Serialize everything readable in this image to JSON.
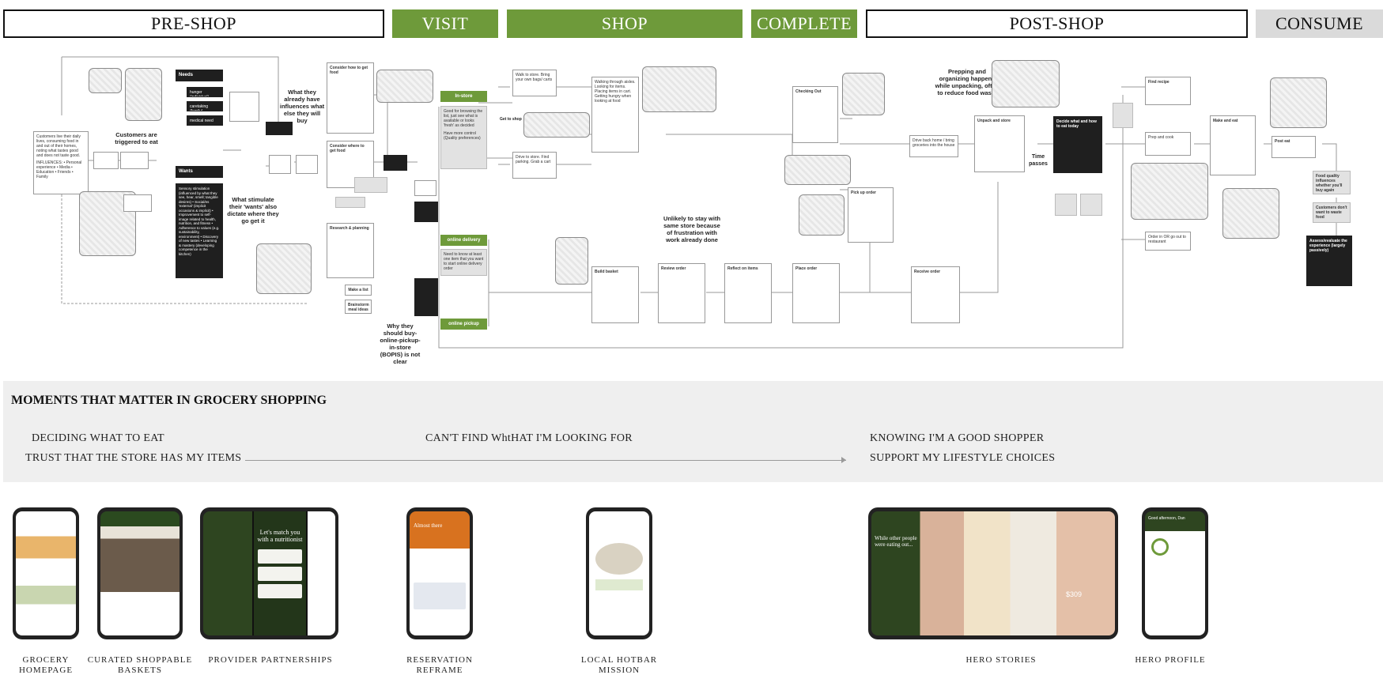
{
  "phases": {
    "pre_shop": "PRE-SHOP",
    "visit": "VISIT",
    "shop": "SHOP",
    "complete": "COMPLETE",
    "post_shop": "POST-SHOP",
    "consume": "CONSUME"
  },
  "colors": {
    "accent_green": "#6e9a3a",
    "dark_box": "#1f1f1f",
    "band_bg": "#efefef"
  },
  "flow": {
    "triggered": "Customers are triggered to eat",
    "needs": "Needs",
    "need_hunger": "hunger (individual)",
    "need_caretaking": "caretaking (family)",
    "need_medical": "medical need",
    "wants": "Wants",
    "wants_body": "Sensory stimulation (influenced by what they see, hear, smell; tangible desires) • Social/es 'external' (implicit occasions & implicit) • Improvement to self-image related to health, nutrition, and fitness • Adherence to values (e.g. sustainability, environment) • Discovery of new tastes • Learning & mastery (developing competence in the kitchen)",
    "customers_daily": "Customers live their daily lives, consuming food in and out of their homes, noting what tastes good and does not taste good.",
    "influences": "INFLUENCES: • Personal experience • Media • Education • Friends • Family",
    "annot_influence": "What they already have influences what else they will buy",
    "annot_wants": "What stimulate their 'wants' also dictate where they go get it",
    "consider_how": "Consider how to get food",
    "consider_where": "Consider where to get food",
    "research": "Research & planning",
    "make_list": "Make a list",
    "brainstorm": "Brainstorm meal ideas",
    "in_store": "In-store",
    "online_delivery": "online delivery",
    "online_pickup": "online pickup",
    "in_store_note": "Good for browsing the list, just see what is available or looks 'fresh' as decided",
    "in_store_note2": "Have more control (Quality preferences)",
    "delivery_note": "Need to know at least one item that you want to start online delivery order",
    "get_to_shop": "Get to shop",
    "walk": "Walk to store. Bring your own bags/ carts",
    "drive": "Drive to store. Find parking. Grab a cart",
    "browse": "Walking through aisles. Looking for items. Placing items in cart. Getting hungry when looking at food",
    "annot_bopis": "Why they should buy-online-pickup-in-store (BOPIS) is not clear",
    "annot_frustration": "Unlikely to stay with same store because of frustration with work already done",
    "build_basket": "Build basket",
    "review_order": "Review order",
    "reflect_items": "Reflect on items",
    "place_order": "Place order",
    "checkout": "Checking Out",
    "pickup_order": "Pick up order",
    "receive_order": "Receive order",
    "drive_home": "Drive back home / bring groceries into the house",
    "unpack": "Unpack and store",
    "time_passes": "Time passes",
    "annot_waste": "Prepping and organizing happens while unpacking, often to reduce food waste",
    "decide_eat": "Decide what and how to eat today",
    "prep_cook": "Prep and cook",
    "order_out": "Order in OR go out to restaurant",
    "make_eat": "Make and eat",
    "post_eat": "Post eat",
    "find_recipe": "Find recipe",
    "food_quality": "Food quality influences whether you'll buy again",
    "dont_waste": "Customers don't want to waste food",
    "assess": "Assess/evaluate the experience (largely passively)"
  },
  "moments": {
    "title": "MOMENTS THAT MATTER IN GROCERY SHOPPING",
    "deciding": "DECIDING WHAT TO EAT",
    "trust": "TRUST THAT THE STORE HAS MY ITEMS",
    "cant_find": "CAN'T FIND WhtHAT I'M LOOKING FOR",
    "good_shopper": "KNOWING I'M A GOOD SHOPPER",
    "lifestyle": "SUPPORT MY LIFESTYLE CHOICES"
  },
  "screens": {
    "grocery_homepage": "GROCERY HOMEPAGE",
    "curated_baskets": "CURATED SHOPPABLE BASKETS",
    "provider_partnerships": "PROVIDER PARTNERSHIPS",
    "reservation_reframe": "RESERVATION REFRAME",
    "local_hotbar": "LOCAL HOTBAR MISSION",
    "hero_stories": "HERO STORIES",
    "hero_profile": "HERO PROFILE",
    "nutritionist": "Let's match you with a nutritionist",
    "almost_there": "Almost there",
    "hero_story_1": "While other people were eating out...",
    "good_afternoon": "Good afternoon, Dan",
    "hero_price": "$309"
  }
}
